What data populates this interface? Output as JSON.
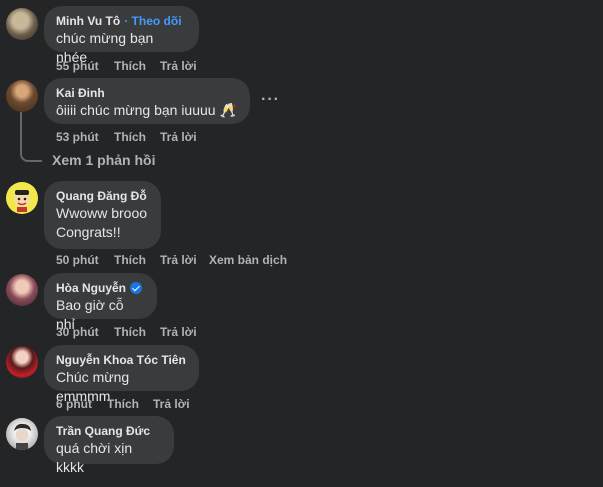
{
  "comments": [
    {
      "name": "Minh Vu Tô",
      "follow": "· Theo dõi",
      "text": "chúc mừng bạn nhée",
      "time": "55 phút",
      "like": "Thích",
      "reply": "Trả lời"
    },
    {
      "name": "Kai Đinh",
      "text": "ôiiii chúc mừng bạn iuuuu 🥂",
      "time": "53 phút",
      "like": "Thích",
      "reply": "Trả lời",
      "more": "···",
      "view_replies": "Xem 1 phản hồi"
    },
    {
      "name": "Quang Đăng Đỗ",
      "text": "Wwoww brooo\nCongrats!!",
      "time": "50 phút",
      "like": "Thích",
      "reply": "Trả lời",
      "translate": "Xem bản dịch"
    },
    {
      "name": "Hòa Nguyễn",
      "text": "Bao giờ cỗ nhỉ",
      "time": "30 phút",
      "like": "Thích",
      "reply": "Trả lời"
    },
    {
      "name": "Nguyễn Khoa Tóc Tiên",
      "text": "Chúc mừng emmmm",
      "time": "6 phút",
      "like": "Thích",
      "reply": "Trả lời"
    },
    {
      "name": "Trần Quang Đức",
      "text": "quá chời xịn kkkk"
    }
  ],
  "colors": {
    "background": "#242526",
    "bubble": "#3a3b3c",
    "link": "#4599ff",
    "meta": "#b0b3b8"
  }
}
